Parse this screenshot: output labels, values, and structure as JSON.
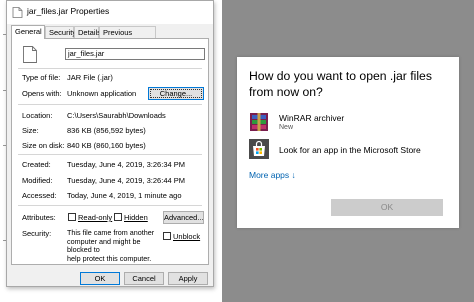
{
  "properties_window": {
    "title": "jar_files.jar Properties",
    "tabs": [
      {
        "label": "General",
        "active": true
      },
      {
        "label": "Security"
      },
      {
        "label": "Details"
      },
      {
        "label": "Previous Versions"
      }
    ],
    "file_name": "jar_files.jar",
    "type_of_file_label": "Type of file:",
    "type_of_file_value": "JAR File (.jar)",
    "opens_with_label": "Opens with:",
    "opens_with_value": "Unknown application",
    "change_button": "Change...",
    "location_label": "Location:",
    "location_value": "C:\\Users\\Saurabh\\Downloads",
    "size_label": "Size:",
    "size_value": "836 KB (856,592 bytes)",
    "size_on_disk_label": "Size on disk:",
    "size_on_disk_value": "840 KB (860,160 bytes)",
    "created_label": "Created:",
    "created_value": "Tuesday, June 4, 2019, 3:26:34 PM",
    "modified_label": "Modified:",
    "modified_value": "Tuesday, June 4, 2019, 3:26:44 PM",
    "accessed_label": "Accessed:",
    "accessed_value": "Today, June 4, 2019, 1 minute ago",
    "attributes_label": "Attributes:",
    "readonly_label": "Read-only",
    "hidden_label": "Hidden",
    "advanced_button": "Advanced...",
    "security_label": "Security:",
    "security_line1": "This file came from another",
    "security_line2": "computer and might be blocked to",
    "security_line3": "help protect this computer.",
    "unblock_label": "Unblock",
    "ok_button": "OK",
    "cancel_button": "Cancel",
    "apply_button": "Apply"
  },
  "open_with_dialog": {
    "question_line1": "How do you want to open .jar files",
    "question_line2": "from now on?",
    "apps": [
      {
        "name": "WinRAR archiver",
        "sub": "New",
        "icon": "winrar-icon"
      },
      {
        "name": "Look for an app in the Microsoft Store",
        "icon": "store-icon"
      }
    ],
    "more_apps_label": "More apps",
    "more_apps_arrow": "↓",
    "ok_button": "OK"
  },
  "colors": {
    "accent": "#0078d7",
    "link": "#0063b1",
    "background_dim": "#8c8c8c"
  }
}
